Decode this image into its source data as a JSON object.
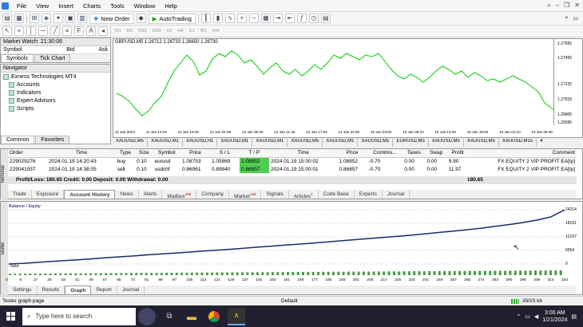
{
  "menu": [
    "File",
    "View",
    "Insert",
    "Charts",
    "Tools",
    "Window",
    "Help"
  ],
  "toolbar": {
    "new_order": "New Order",
    "auto_trading": "AutoTrading",
    "timeframes": [
      "M1",
      "M5",
      "M15",
      "M30",
      "H1",
      "H4",
      "D1",
      "W1",
      "MN"
    ]
  },
  "market_watch": {
    "title": "Market Watch: 21:30:06",
    "col_symbol": "Symbol",
    "col_bid": "Bid",
    "col_ask": "Ask",
    "tabs": [
      "Symbols",
      "Tick Chart"
    ]
  },
  "navigator": {
    "title": "Navigator",
    "items": [
      "Exness Technologies MT4",
      "Accounts",
      "Indicators",
      "Expert Advisors",
      "Scripts"
    ],
    "tabs": [
      "Common",
      "Favorites"
    ]
  },
  "chart": {
    "symbol": "GBPUSD,M5 1.26712 1.26733 1.26650 1.26730",
    "price_ticks": [
      "1.27655",
      "1.27455",
      "1.27225",
      "1.27015",
      "1.26805",
      "1.26595"
    ],
    "time_ticks": [
      "11 Jan 2024",
      "11 Jan 14:25",
      "11 Jan 19:45",
      "12 Jan 01:05",
      "12 Jan 06:25",
      "12 Jan 11:45",
      "12 Jan 17:05",
      "14 Jan 22:30",
      "15 Jan 03:50",
      "15 Jan 09:10",
      "15 Jan 14:30",
      "15 Jan 19:50",
      "16 Jan 01:10",
      "16 Jan 06:30"
    ],
    "tabs": [
      "XAUUSD,M5",
      "XAUUSD,M1",
      "XAUUSD,H1",
      "XAUUSD,M1",
      "XAUUSD,M1",
      "XAUUSD,M5",
      "XAUUSD,M1",
      "XAUUSD,M1",
      "EURUSD,M5",
      "XAUUSD,M5",
      "XAUUSD,M5",
      "XAUUSD,M15",
      "4"
    ]
  },
  "orders": {
    "headers": [
      "Order",
      "Time",
      "Type",
      "Size",
      "Symbol",
      "Price",
      "S / L",
      "T / P",
      "Time",
      "Price",
      "Commis...",
      "Taxes",
      "Swap",
      "Profit",
      "Comment"
    ],
    "rows": [
      [
        "229029276",
        "2024.01.19 14:20:43",
        "buy",
        "0.10",
        "eurusd",
        "1.08753",
        "1.05869",
        "1.08852",
        "2024.01.19 15:00:02",
        "1.08852",
        "-0.70",
        "0.00",
        "0.00",
        "9.90",
        "FX EQUITY 2 VIP PROFIT EA[tp]"
      ],
      [
        "229041937",
        "2024.01.19 14:38:05",
        "sell",
        "0.10",
        "usdchf",
        "0.86961",
        "0.89840",
        "0.86857",
        "2024.01.19 15:00:01",
        "0.86857",
        "-0.70",
        "0.00",
        "0.00",
        "11.97",
        "FX EQUITY 2 VIP PROFIT EA[tp]"
      ]
    ],
    "summary": "Profit/Loss: 180.65  Credit: 0.00  Deposit: 0.00  Withdrawal: 0.00",
    "summary_total": "180.65"
  },
  "terminal_tabs": [
    "Trade",
    "Exposure",
    "Account History",
    "News",
    "Alerts",
    "Mailbox",
    "Company",
    "Market",
    "Signals",
    "Articles",
    "Code Base",
    "Experts",
    "Journal"
  ],
  "terminal_badges": {
    "mailbox": "156",
    "market": "128",
    "articles": "1"
  },
  "terminal_label": "Terminal",
  "graph": {
    "legend": "Balance / Equity",
    "size_label": "Size",
    "y_ticks": [
      "24214",
      "18161",
      "12107",
      "6054",
      "0"
    ],
    "x_ticks": [
      "0",
      "9",
      "17",
      "25",
      "33",
      "41",
      "49",
      "57",
      "65",
      "73",
      "81",
      "89",
      "97",
      "105",
      "113",
      "121",
      "129",
      "137",
      "145",
      "153",
      "161",
      "169",
      "177",
      "185",
      "193",
      "201",
      "209",
      "217",
      "225",
      "233",
      "241",
      "249",
      "257",
      "265",
      "274",
      "282",
      "290",
      "298",
      "306",
      "314",
      "323"
    ],
    "balance_series": [
      0,
      300,
      700,
      1100,
      1500,
      1900,
      2300,
      2800,
      3200,
      3600,
      4100,
      4500,
      4900,
      5300,
      5800,
      6200,
      6600,
      7100,
      7600,
      8000,
      8500,
      8900,
      9400,
      9900,
      10400,
      10900,
      11400,
      11900,
      12400,
      12900,
      13500,
      14100,
      14700,
      15300,
      16000,
      16800,
      17600,
      18500,
      19600,
      21000,
      24214
    ]
  },
  "tester_tabs": [
    "Settings",
    "Results",
    "Graph",
    "Report",
    "Journal"
  ],
  "tester_label": "Tester",
  "status": {
    "left": "Tester graph page",
    "mid": "Default",
    "right": "350/3 kb"
  },
  "taskbar": {
    "search": "Type here to search",
    "time": "3:00 AM",
    "date": "1/21/2024"
  }
}
